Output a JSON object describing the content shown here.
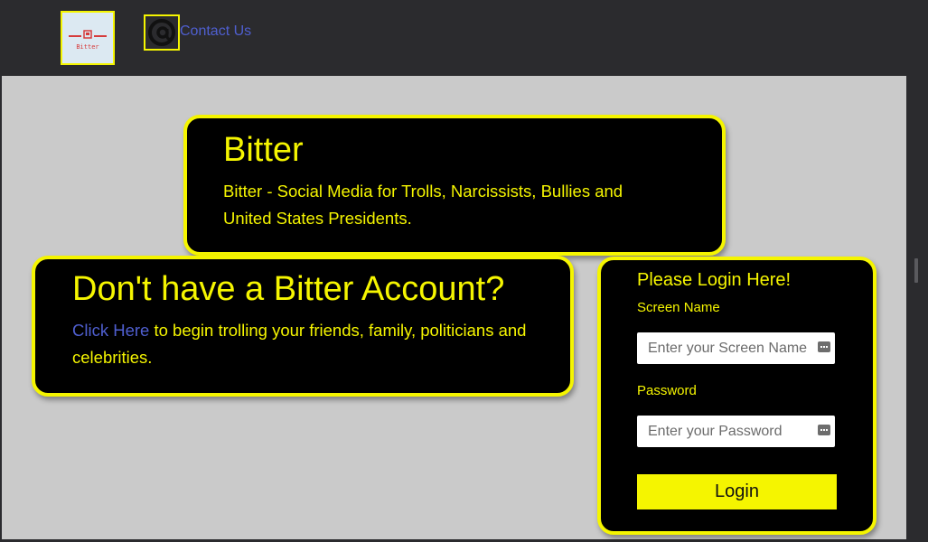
{
  "nav": {
    "logo_text": "Bitter",
    "contact_label": "Contact Us"
  },
  "hero": {
    "title": "Bitter",
    "description": "Bitter - Social Media for Trolls, Narcissists, Bullies and United States Presidents."
  },
  "signup": {
    "title": "Don't have a Bitter Account?",
    "link_text": "Click Here",
    "text": " to begin trolling your friends, family, politicians and celebrities."
  },
  "login": {
    "title": "Please Login Here!",
    "screen_name_label": "Screen Name",
    "screen_name_placeholder": "Enter your Screen Name",
    "screen_name_value": "",
    "password_label": "Password",
    "password_placeholder": "Enter your Password",
    "password_value": "",
    "button_label": "Login"
  },
  "colors": {
    "accent": "#f5f500",
    "panel": "#000000",
    "link": "#4f5fd0",
    "page_bg": "#cacaca",
    "topbar": "#2b2b2e"
  },
  "icons": [
    "bitter-logo-icon",
    "contact-at-icon",
    "password-manager-key-icon"
  ]
}
